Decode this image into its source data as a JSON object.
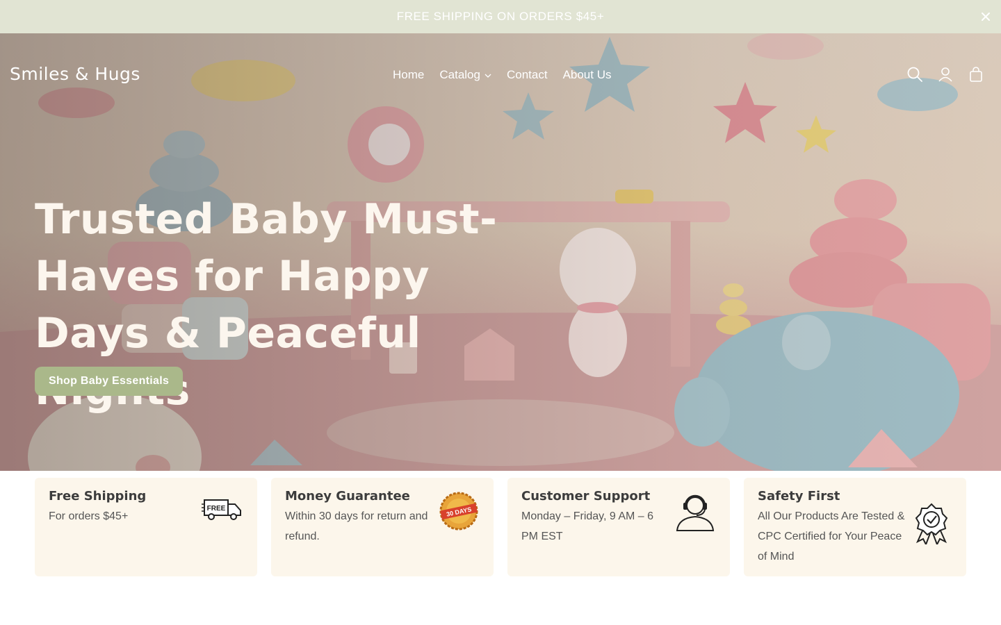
{
  "announcement": {
    "text": "FREE SHIPPING ON ORDERS $45+",
    "close_icon": "close-icon"
  },
  "header": {
    "logo": "Smiles & Hugs",
    "nav": [
      {
        "label": "Home"
      },
      {
        "label": "Catalog",
        "has_dropdown": true
      },
      {
        "label": "Contact"
      },
      {
        "label": "About Us"
      }
    ],
    "icons": [
      "search-icon",
      "account-icon",
      "cart-icon"
    ]
  },
  "hero": {
    "title": "Trusted Baby Must-Haves for Happy Days & Peaceful Nights",
    "button_label": "Shop Baby Essentials"
  },
  "features": [
    {
      "title": "Free Shipping",
      "desc": "For orders $45+",
      "icon": "free-delivery-truck-icon",
      "badge_text": "FREE"
    },
    {
      "title": "Money Guarantee",
      "desc": "Within 30 days for return and refund.",
      "icon": "money-back-badge-icon",
      "badge_text": "30 DAYS"
    },
    {
      "title": "Customer Support",
      "desc": "Monday – Friday, 9 AM – 6 PM EST",
      "icon": "headset-support-icon"
    },
    {
      "title": "Safety First",
      "desc": "All Our Products Are Tested & CPC Certified for Your Peace of Mind",
      "icon": "certified-ribbon-icon"
    }
  ],
  "colors": {
    "announcement_bg": "#e1e4d3",
    "button_bg": "#aab88a",
    "card_bg": "#fcf6eb",
    "hero_text": "#fcf6ee"
  }
}
